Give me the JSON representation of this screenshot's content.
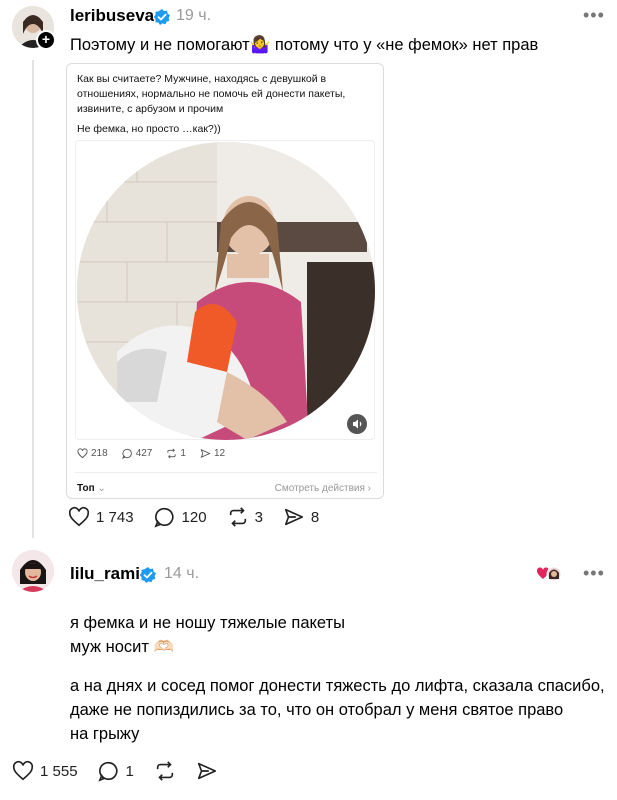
{
  "post1": {
    "username": "leribuseva",
    "time": "19 ч.",
    "text": "Поэтому и не помогают🤷‍♀️ потому что у «не фемок» нет прав",
    "embed": {
      "question": "Как вы считаете? Мужчине, находясь с девушкой в отношениях, нормально не помочь ей донести пакеты, извините, с арбузом и прочим",
      "caption": "Не фемка, но просто …как?))",
      "stats": {
        "likes": "218",
        "comments": "427",
        "reposts": "1",
        "shares": "12"
      },
      "sort_label": "Топ",
      "actions_label": "Смотреть действия"
    },
    "likes": "1 743",
    "comments": "120",
    "reposts": "3",
    "shares": "8"
  },
  "post2": {
    "username": "lilu_rami",
    "time": "14 ч.",
    "text_line1": "я фемка и не ношу тяжелые пакеты",
    "text_line2": "муж носит 🫶🏻",
    "text_p2_line1": "а на днях и сосед помог донести тяжесть до лифта, сказала спасибо,",
    "text_p2_line2": "даже не попиздились за то, что он отобрал у меня святое право",
    "text_p2_line3": "на грыжу",
    "likes": "1 555",
    "comments": "1"
  },
  "icons": {
    "verified": "verified-badge-icon",
    "more": "more-icon",
    "like": "heart-icon",
    "comment": "comment-icon",
    "repost": "repost-icon",
    "share": "share-icon"
  },
  "colors": {
    "verified": "#1d9bf0",
    "muted": "#9a9a9a",
    "divider": "#e3e3e3"
  }
}
